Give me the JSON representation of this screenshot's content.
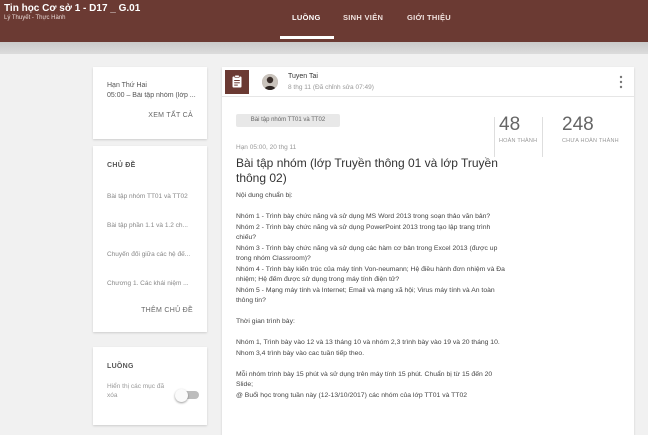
{
  "app": {
    "title": "Tin học Cơ sở 1 - D17 _ G.01",
    "subtitle": "Lý Thuyết - Thực Hành"
  },
  "nav": {
    "tabs": [
      {
        "label": "LUỒNG",
        "active": true
      },
      {
        "label": "SINH VIÊN",
        "active": false
      },
      {
        "label": "GIỚI THIỆU",
        "active": false
      }
    ]
  },
  "upcoming": {
    "title": "Hạn Thứ Hai",
    "item": "05:00 – Bài tập nhóm (lớp ...",
    "view_all": "XEM TẤT CẢ"
  },
  "topics": {
    "heading": "CHỦ ĐỀ",
    "items": [
      "Bài tập nhóm TT01 và TT02",
      "Bài tập phần 1.1 và 1.2 ch...",
      "Chuyển đổi giữa các hệ đế...",
      "Chương 1. Các khái niệm ..."
    ],
    "add_label": "THÊM CHỦ ĐỀ"
  },
  "stream_settings": {
    "heading": "LUỒNG",
    "option_label": "Hiển thị các mục đã xóa",
    "option_enabled": false
  },
  "post": {
    "author": "Tuyen Tai",
    "time": "8 thg 11 (Đã chỉnh sửa 07:49)",
    "topic_chip": "Bài tập nhóm TT01 và TT02",
    "due": "Hạn 05:00, 20 thg 11",
    "completed_count": "48",
    "completed_label": "HOÀN THÀNH",
    "not_completed_count": "248",
    "not_completed_label": "CHƯA HOÀN THÀNH",
    "title": "Bài tập nhóm (lớp Truyền thông 01 và lớp Truyền thông 02)",
    "body": {
      "intro": "Nội dung chuẩn bị:",
      "group1": "Nhóm 1 - Trình bày chức năng và sử dụng MS Word 2013 trong soạn thảo văn bản?",
      "group2": "Nhóm 2 - Trình bày chức năng và sử dụng PowerPoint 2013 trong tạo lập trang trình chiếu?",
      "group3": "Nhóm 3 - Trình bày chức năng và sử dụng các hàm cơ bản trong Excel 2013 (được up trong nhóm Classroom)?",
      "group4": "Nhóm 4 - Trình bày kiến trúc của máy tính Von-neumann; Hệ điều hành đơn nhiệm và Đa nhiệm; Hệ đếm được sử dụng trong máy tính điện tử?",
      "group5": "Nhóm 5 - Mạng máy tính và Internet; Email và mạng xã hội; Virus máy tính và An toàn thông tin?",
      "schedule_heading": "Thời gian trình bày:",
      "schedule": "Nhóm 1, Trình bày vào 12 và 13 tháng 10 và nhóm 2,3 trình bày vào 19 và 20 tháng 10. Nhom 3,4 trình bày vào cac tuần tiếp theo.",
      "rule": "Mỗi nhóm trình bày 15 phút và sử dụng trên máy tính 15 phút. Chuẩn bị từ 15 đến 20 Slide;",
      "note": "@ Buổi học trong tuần này (12-13/10/2017) các nhóm của lớp TT01 và TT02"
    }
  },
  "colors": {
    "header": "#6b3a33",
    "background": "#f1f1f1"
  }
}
